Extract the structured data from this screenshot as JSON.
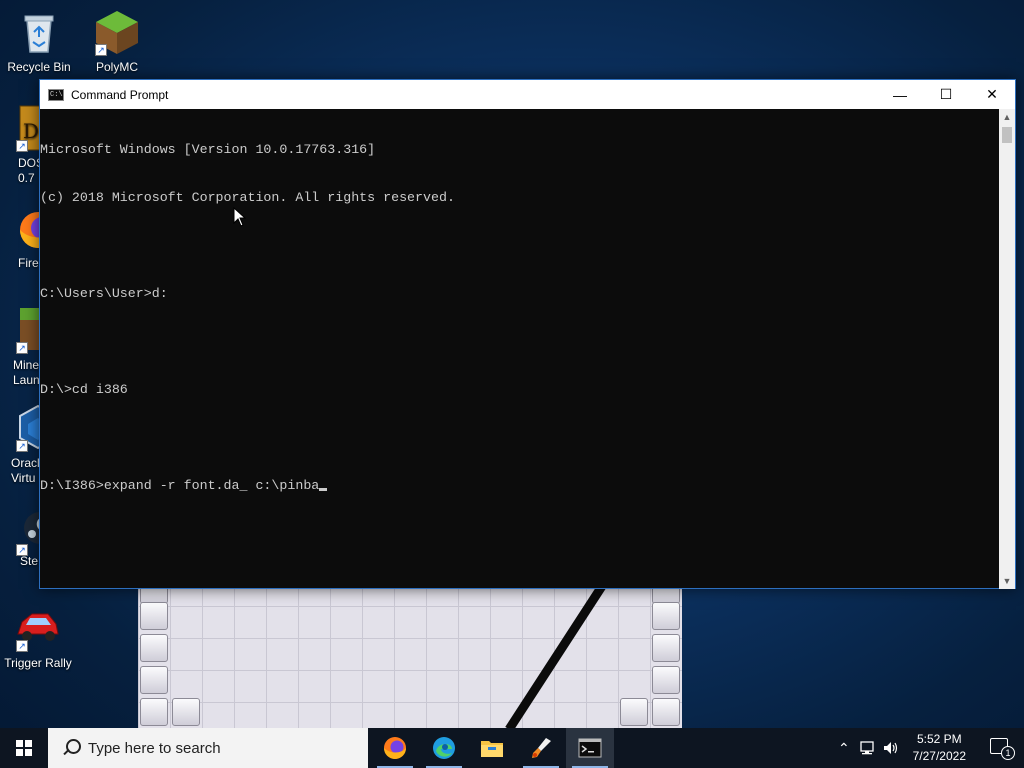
{
  "desktop": {
    "icons": [
      {
        "label": "Recycle Bin",
        "icon": "recycle-bin-icon"
      },
      {
        "label": "PolyMC",
        "icon": "polymc-icon"
      },
      {
        "label": "DOS\n0.7",
        "icon": "dosbox-icon"
      },
      {
        "label": "Fire",
        "icon": "firefox-icon"
      },
      {
        "label": "Mine\nLaun",
        "icon": "minecraft-launcher-icon"
      },
      {
        "label": "Oracl\nVirtu",
        "icon": "virtualbox-icon"
      },
      {
        "label": "Ste",
        "icon": "steam-icon"
      },
      {
        "label": "Trigger Rally",
        "icon": "trigger-rally-icon"
      }
    ]
  },
  "cmd_window": {
    "title": "Command Prompt",
    "controls": {
      "minimize": "—",
      "maximize": "☐",
      "close": "✕"
    },
    "lines": [
      "Microsoft Windows [Version 10.0.17763.316]",
      "(c) 2018 Microsoft Corporation. All rights reserved.",
      "",
      "C:\\Users\\User>d:",
      "",
      "D:\\>cd i386",
      "",
      "D:\\I386>expand -r font.da_ c:\\pinba"
    ]
  },
  "taskbar": {
    "search_placeholder": "Type here to search",
    "apps": [
      {
        "name": "Firefox",
        "icon": "firefox-icon"
      },
      {
        "name": "Microsoft Edge",
        "icon": "edge-icon"
      },
      {
        "name": "File Explorer",
        "icon": "folder-icon"
      },
      {
        "name": "Paint",
        "icon": "paint-brush-icon"
      },
      {
        "name": "Command Prompt",
        "icon": "cmd-icon"
      }
    ],
    "time": "5:52 PM",
    "date": "7/27/2022",
    "notification_count": "1"
  }
}
